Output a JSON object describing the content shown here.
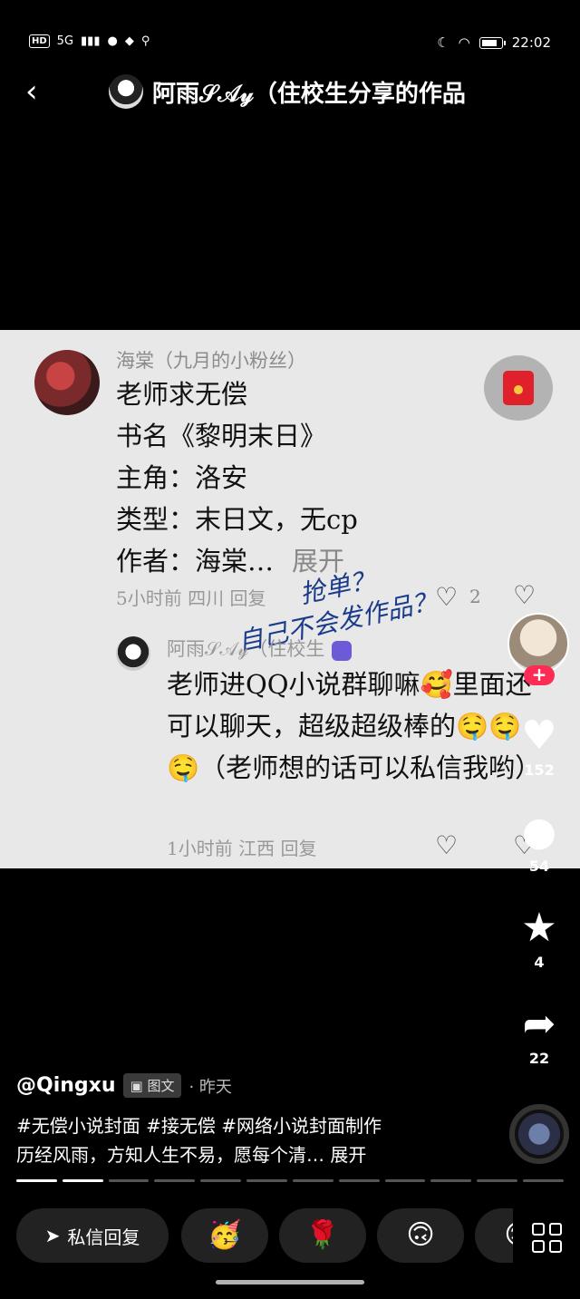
{
  "status_bar": {
    "network": "5G",
    "hd": "HD",
    "time": "22:02",
    "battery_level": 0.9
  },
  "header": {
    "title": "阿雨𝒮𝒜𝓎（住校生分享的作品"
  },
  "comment1": {
    "name": "海棠（九月的小粉丝）",
    "lines": [
      "老师求无偿",
      "书名《黎明末日》",
      "主角：洛安",
      "类型：末日文，无cp",
      "作者：海棠…"
    ],
    "expand": "展开",
    "meta": "5小时前 四川   回复",
    "likes": "2"
  },
  "handwriting": {
    "line1": "抢单？",
    "line2": "自己不会发作品？"
  },
  "comment2": {
    "name": "阿雨𝒮𝒜𝓎（住校生",
    "body": "老师进QQ小说群聊嘛🥰里面还可以聊天，超级超级棒的🤤🤤🤤（老师想的话可以私信我哟）",
    "meta": "1小时前 江西   回复"
  },
  "rail": {
    "likes": "152",
    "comments": "54",
    "favorites": "4",
    "shares": "22"
  },
  "post": {
    "author": "@Qingxu",
    "type_label": "图文",
    "time": "· 昨天",
    "hashtags": "#无偿小说封面 #接无偿 #网络小说封面制作",
    "caption": "历经风雨，方知人生不易，愿每个清… 展开"
  },
  "bottom": {
    "dm_label": "私信回复",
    "q1": "🥳",
    "q2": "🌹",
    "q3": "🙃",
    "q4": "😊"
  },
  "progress": {
    "total_slides": 12,
    "current": 2
  }
}
